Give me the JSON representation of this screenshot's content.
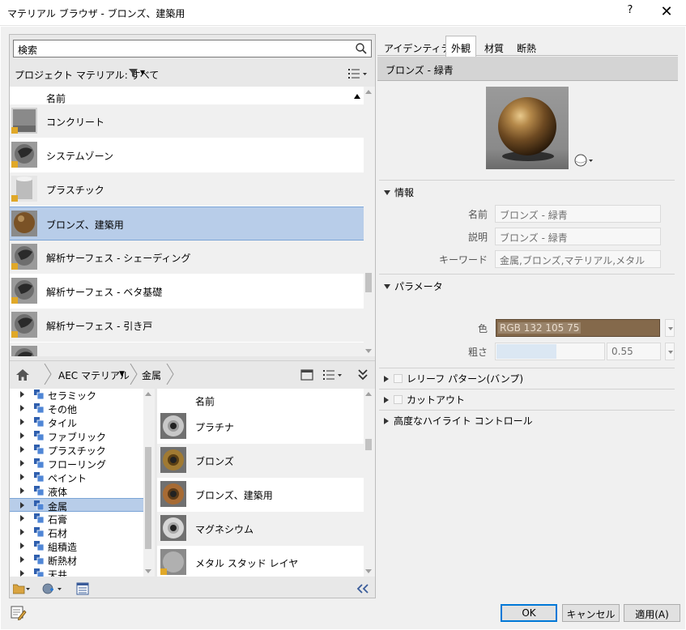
{
  "window": {
    "title": "マテリアル ブラウザ - ブロンズ、建築用",
    "help": "?",
    "close": "✕"
  },
  "search": {
    "placeholder": "検索"
  },
  "project": {
    "filter_label": "プロジェクト マテリアル: すべて",
    "column_name": "名前",
    "items": [
      {
        "label": "コンクリート"
      },
      {
        "label": "システムゾーン"
      },
      {
        "label": "プラスチック"
      },
      {
        "label": "ブロンズ、建築用"
      },
      {
        "label": "解析サーフェス - シェーディング"
      },
      {
        "label": "解析サーフェス - ベタ基礎"
      },
      {
        "label": "解析サーフェス - 引き戸"
      }
    ],
    "selected_index": 3
  },
  "library": {
    "breadcrumb": [
      "AEC マテリアル",
      "金属"
    ],
    "tree": [
      "セラミック",
      "その他",
      "タイル",
      "ファブリック",
      "プラスチック",
      "フローリング",
      "ペイント",
      "液体",
      "金属",
      "石膏",
      "石材",
      "組積造",
      "断熱材",
      "天井"
    ],
    "tree_selected_index": 8,
    "column_name": "名前",
    "items": [
      {
        "label": "プラチナ"
      },
      {
        "label": "ブロンズ"
      },
      {
        "label": "ブロンズ、建築用"
      },
      {
        "label": "マグネシウム"
      },
      {
        "label": "メタル スタッド レイヤ"
      }
    ]
  },
  "tabs": [
    "アイデンティティ",
    "外観",
    "材質",
    "断熱"
  ],
  "active_tab_index": 1,
  "asset": {
    "name": "ブロンズ - 緑青",
    "info": {
      "title": "情報",
      "name_label": "名前",
      "name_value": "ブロンズ - 緑青",
      "desc_label": "説明",
      "desc_value": "ブロンズ - 緑青",
      "keyword_label": "キーワード",
      "keyword_value": "金属,ブロンズ,マテリアル,メタル"
    },
    "params": {
      "title": "パラメータ",
      "color_label": "色",
      "color_value": "RGB 132 105 75",
      "color_hex": "#84694b",
      "roughness_label": "粗さ",
      "roughness_value": "0.55",
      "roughness_fraction": 0.55
    },
    "relief": "レリーフ パターン(バンプ)",
    "cutout": "カットアウト",
    "advanced": "高度なハイライト コントロール"
  },
  "buttons": {
    "ok": "OK",
    "cancel": "キャンセル",
    "apply": "適用(A)"
  }
}
